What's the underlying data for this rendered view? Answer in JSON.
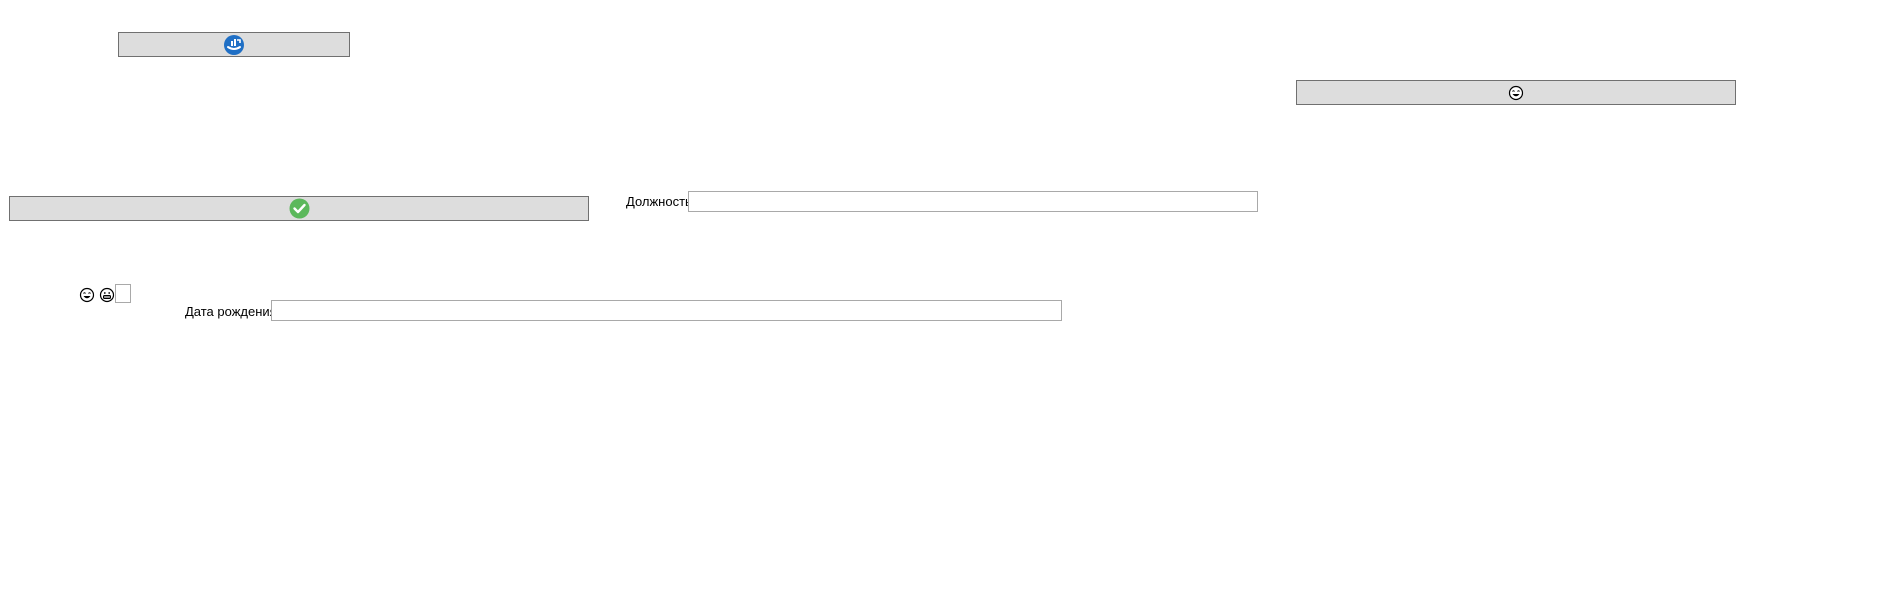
{
  "form": {
    "position_label": "Должность",
    "position_value": "",
    "birthdate_label": "Дата рождения",
    "birthdate_value": "",
    "checkbox_checked": false
  },
  "icons": {
    "top_left_button": "sync-cloud-icon",
    "top_right_button": "emoji-face-icon",
    "confirm_button": "checkmark-icon",
    "small_face_1": "emoji-laugh-icon",
    "small_face_2": "emoji-grin-icon"
  },
  "colors": {
    "button_bg": "#dddddd",
    "button_border": "#707070",
    "accent_blue": "#1f6fc5",
    "accent_green": "#5cb85c"
  }
}
